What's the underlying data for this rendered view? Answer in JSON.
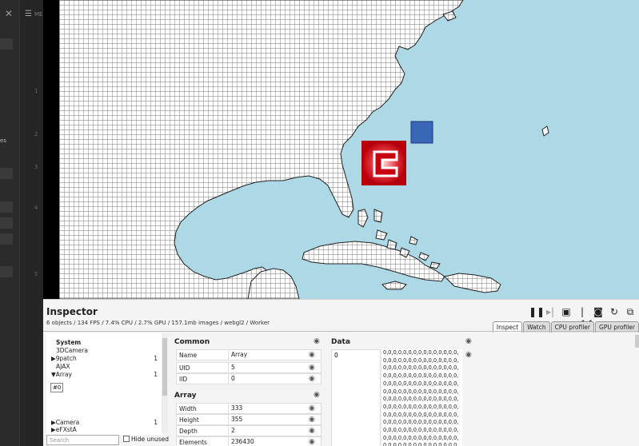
{
  "editor": {
    "menu_icon": "menu-icon",
    "menu_label": "ME",
    "line_numbers": [
      "1",
      "2",
      "3",
      "4",
      "5"
    ],
    "tab_fragment": "es"
  },
  "inspector": {
    "title": "Inspector",
    "stats": "6 objects / 134 FPS / 7.4% CPU / 2.7% GPU / 157.1mb images / webgl2 / Worker",
    "toolbar_icons": [
      "pause-icon",
      "step-icon",
      "save-icon",
      "rewind-icon",
      "camera-icon",
      "reload-icon",
      "popout-icon"
    ],
    "tabs": [
      "Inspect",
      "Watch",
      "CPU profiler",
      "GPU profiler"
    ],
    "active_tab": "Inspect",
    "tree": [
      {
        "label": "System",
        "count": "",
        "bold": true
      },
      {
        "label": "3DCamera",
        "count": ""
      },
      {
        "label": "▶9patch",
        "count": "1"
      },
      {
        "label": "AJAX",
        "count": ""
      },
      {
        "label": "▼Array",
        "count": "1"
      },
      {
        "label": "#0",
        "count": ""
      },
      {
        "label": "▶Camera",
        "count": "1"
      },
      {
        "label": "▶eFXstA",
        "count": ""
      }
    ],
    "search_placeholder": "Search",
    "hide_unused_label": "Hide unused",
    "common": {
      "heading": "Common",
      "rows": [
        {
          "key": "Name",
          "value": "Array"
        },
        {
          "key": "UID",
          "value": "5"
        },
        {
          "key": "IID",
          "value": "0"
        }
      ]
    },
    "array": {
      "heading": "Array",
      "rows": [
        {
          "key": "Width",
          "value": "333"
        },
        {
          "key": "Height",
          "value": "355"
        },
        {
          "key": "Depth",
          "value": "2"
        },
        {
          "key": "Elements",
          "value": "236430"
        }
      ]
    },
    "data": {
      "heading": "Data",
      "index": "0",
      "value_line": "0,0,0,0,0,0,0,0,0,0,0,0,0,0,0,",
      "line_count": 13
    }
  },
  "colors": {
    "ocean": "#add8e6",
    "land": "#ffffff",
    "marker_blue": "#3a66b8",
    "marker_red": "#cc0a14"
  }
}
